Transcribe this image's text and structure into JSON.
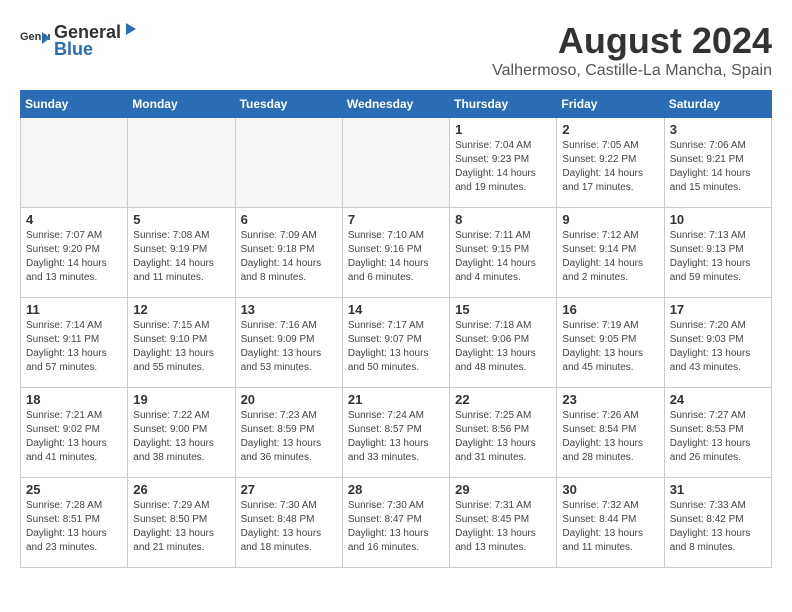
{
  "logo": {
    "general": "General",
    "blue": "Blue"
  },
  "title": "August 2024",
  "subtitle": "Valhermoso, Castille-La Mancha, Spain",
  "headers": [
    "Sunday",
    "Monday",
    "Tuesday",
    "Wednesday",
    "Thursday",
    "Friday",
    "Saturday"
  ],
  "weeks": [
    [
      {
        "day": "",
        "info": ""
      },
      {
        "day": "",
        "info": ""
      },
      {
        "day": "",
        "info": ""
      },
      {
        "day": "",
        "info": ""
      },
      {
        "day": "1",
        "info": "Sunrise: 7:04 AM\nSunset: 9:23 PM\nDaylight: 14 hours\nand 19 minutes."
      },
      {
        "day": "2",
        "info": "Sunrise: 7:05 AM\nSunset: 9:22 PM\nDaylight: 14 hours\nand 17 minutes."
      },
      {
        "day": "3",
        "info": "Sunrise: 7:06 AM\nSunset: 9:21 PM\nDaylight: 14 hours\nand 15 minutes."
      }
    ],
    [
      {
        "day": "4",
        "info": "Sunrise: 7:07 AM\nSunset: 9:20 PM\nDaylight: 14 hours\nand 13 minutes."
      },
      {
        "day": "5",
        "info": "Sunrise: 7:08 AM\nSunset: 9:19 PM\nDaylight: 14 hours\nand 11 minutes."
      },
      {
        "day": "6",
        "info": "Sunrise: 7:09 AM\nSunset: 9:18 PM\nDaylight: 14 hours\nand 8 minutes."
      },
      {
        "day": "7",
        "info": "Sunrise: 7:10 AM\nSunset: 9:16 PM\nDaylight: 14 hours\nand 6 minutes."
      },
      {
        "day": "8",
        "info": "Sunrise: 7:11 AM\nSunset: 9:15 PM\nDaylight: 14 hours\nand 4 minutes."
      },
      {
        "day": "9",
        "info": "Sunrise: 7:12 AM\nSunset: 9:14 PM\nDaylight: 14 hours\nand 2 minutes."
      },
      {
        "day": "10",
        "info": "Sunrise: 7:13 AM\nSunset: 9:13 PM\nDaylight: 13 hours\nand 59 minutes."
      }
    ],
    [
      {
        "day": "11",
        "info": "Sunrise: 7:14 AM\nSunset: 9:11 PM\nDaylight: 13 hours\nand 57 minutes."
      },
      {
        "day": "12",
        "info": "Sunrise: 7:15 AM\nSunset: 9:10 PM\nDaylight: 13 hours\nand 55 minutes."
      },
      {
        "day": "13",
        "info": "Sunrise: 7:16 AM\nSunset: 9:09 PM\nDaylight: 13 hours\nand 53 minutes."
      },
      {
        "day": "14",
        "info": "Sunrise: 7:17 AM\nSunset: 9:07 PM\nDaylight: 13 hours\nand 50 minutes."
      },
      {
        "day": "15",
        "info": "Sunrise: 7:18 AM\nSunset: 9:06 PM\nDaylight: 13 hours\nand 48 minutes."
      },
      {
        "day": "16",
        "info": "Sunrise: 7:19 AM\nSunset: 9:05 PM\nDaylight: 13 hours\nand 45 minutes."
      },
      {
        "day": "17",
        "info": "Sunrise: 7:20 AM\nSunset: 9:03 PM\nDaylight: 13 hours\nand 43 minutes."
      }
    ],
    [
      {
        "day": "18",
        "info": "Sunrise: 7:21 AM\nSunset: 9:02 PM\nDaylight: 13 hours\nand 41 minutes."
      },
      {
        "day": "19",
        "info": "Sunrise: 7:22 AM\nSunset: 9:00 PM\nDaylight: 13 hours\nand 38 minutes."
      },
      {
        "day": "20",
        "info": "Sunrise: 7:23 AM\nSunset: 8:59 PM\nDaylight: 13 hours\nand 36 minutes."
      },
      {
        "day": "21",
        "info": "Sunrise: 7:24 AM\nSunset: 8:57 PM\nDaylight: 13 hours\nand 33 minutes."
      },
      {
        "day": "22",
        "info": "Sunrise: 7:25 AM\nSunset: 8:56 PM\nDaylight: 13 hours\nand 31 minutes."
      },
      {
        "day": "23",
        "info": "Sunrise: 7:26 AM\nSunset: 8:54 PM\nDaylight: 13 hours\nand 28 minutes."
      },
      {
        "day": "24",
        "info": "Sunrise: 7:27 AM\nSunset: 8:53 PM\nDaylight: 13 hours\nand 26 minutes."
      }
    ],
    [
      {
        "day": "25",
        "info": "Sunrise: 7:28 AM\nSunset: 8:51 PM\nDaylight: 13 hours\nand 23 minutes."
      },
      {
        "day": "26",
        "info": "Sunrise: 7:29 AM\nSunset: 8:50 PM\nDaylight: 13 hours\nand 21 minutes."
      },
      {
        "day": "27",
        "info": "Sunrise: 7:30 AM\nSunset: 8:48 PM\nDaylight: 13 hours\nand 18 minutes."
      },
      {
        "day": "28",
        "info": "Sunrise: 7:30 AM\nSunset: 8:47 PM\nDaylight: 13 hours\nand 16 minutes."
      },
      {
        "day": "29",
        "info": "Sunrise: 7:31 AM\nSunset: 8:45 PM\nDaylight: 13 hours\nand 13 minutes."
      },
      {
        "day": "30",
        "info": "Sunrise: 7:32 AM\nSunset: 8:44 PM\nDaylight: 13 hours\nand 11 minutes."
      },
      {
        "day": "31",
        "info": "Sunrise: 7:33 AM\nSunset: 8:42 PM\nDaylight: 13 hours\nand 8 minutes."
      }
    ]
  ]
}
